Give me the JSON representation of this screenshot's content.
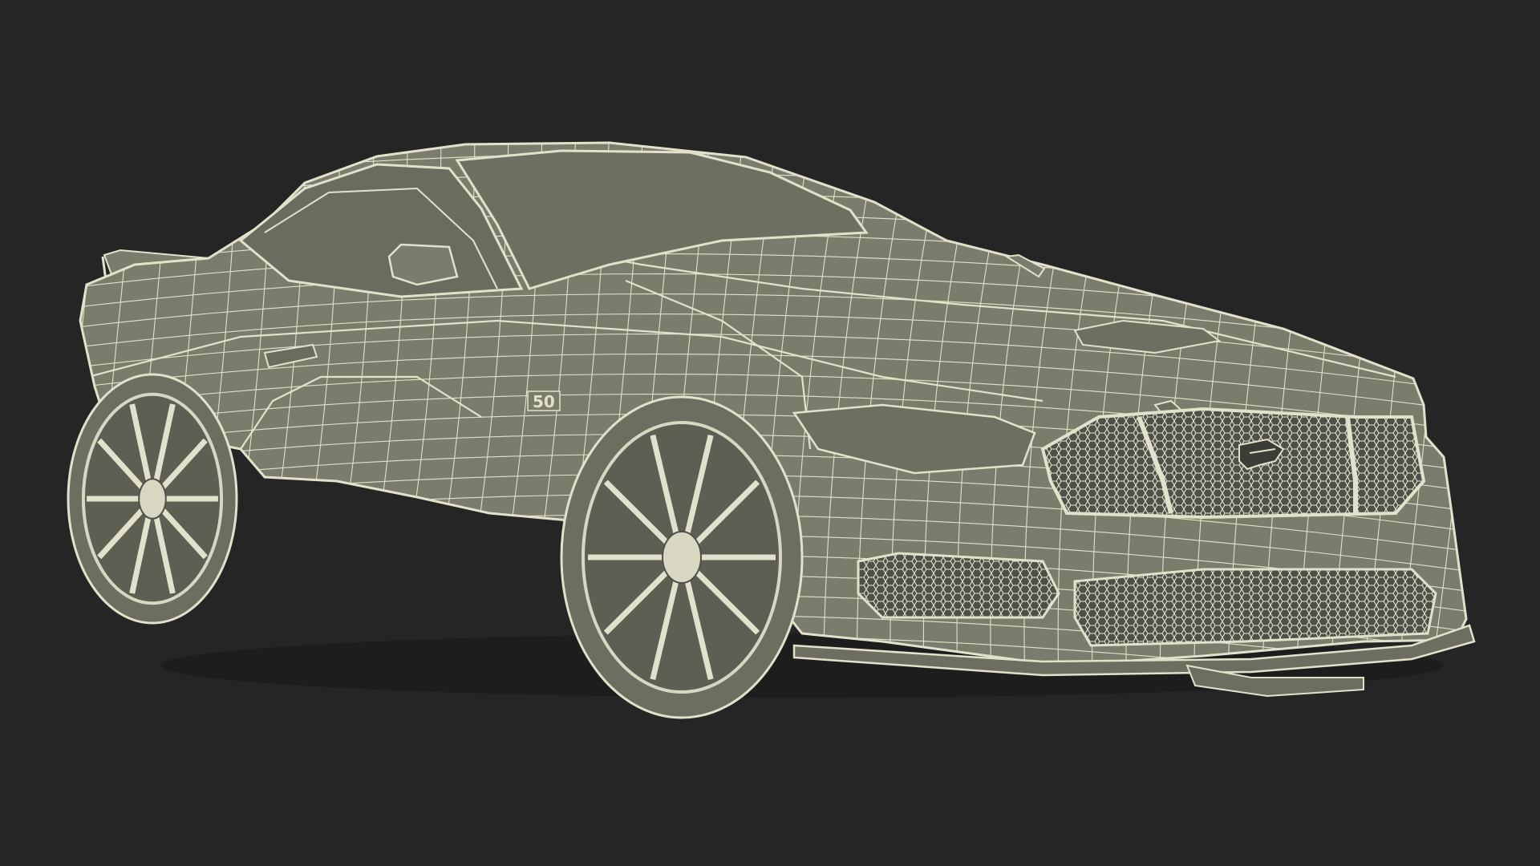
{
  "scene": {
    "subject": "car-wireframe-render",
    "background_color": "#252525",
    "body_fill": "#7c7c6d",
    "body_fill_dark": "#5e5e53",
    "wire_color": "#e2e2cc",
    "tire_color": "#6e6e60",
    "rim_color": "#d8d8c2",
    "grille_color": "#505049"
  },
  "badges": {
    "fender_badge": "50"
  }
}
